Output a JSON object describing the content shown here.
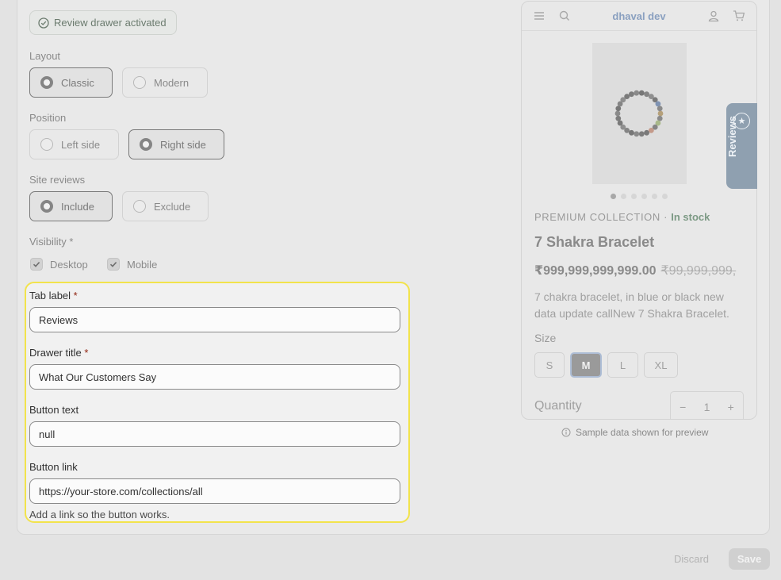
{
  "status_badge": {
    "text": "Review drawer activated"
  },
  "layout": {
    "label": "Layout",
    "options": [
      "Classic",
      "Modern"
    ],
    "selected": "Classic"
  },
  "position": {
    "label": "Position",
    "options": [
      "Left side",
      "Right side"
    ],
    "selected": "Right side"
  },
  "site_reviews": {
    "label": "Site reviews",
    "options": [
      "Include",
      "Exclude"
    ],
    "selected": "Include"
  },
  "visibility": {
    "label": "Visibility *",
    "options": [
      {
        "label": "Desktop",
        "checked": true
      },
      {
        "label": "Mobile",
        "checked": true
      }
    ]
  },
  "form": {
    "tab_label": {
      "label": "Tab label",
      "required_mark": "*",
      "value": "Reviews"
    },
    "drawer_title": {
      "label": "Drawer title",
      "required_mark": "*",
      "value": "What Our Customers Say"
    },
    "button_text": {
      "label": "Button text",
      "value": "null"
    },
    "button_link": {
      "label": "Button link",
      "value": "https://your-store.com/collections/all",
      "help": "Add a link so the button works."
    }
  },
  "preview": {
    "brand": "dhaval dev",
    "collection": "PREMIUM COLLECTION",
    "separator": "·",
    "stock": "In stock",
    "title": "7 Shakra Bracelet",
    "price": "₹999,999,999,999.00",
    "compare_price": "₹99,999,999,",
    "description": "7 chakra bracelet, in blue or black new data update callNew 7 Shakra Bracelet.",
    "size_label": "Size",
    "sizes": [
      "S",
      "M",
      "L",
      "XL"
    ],
    "selected_size": "M",
    "quantity_label": "Quantity",
    "quantity": "1",
    "minus": "−",
    "plus": "+",
    "reviews_tab": "Reviews",
    "sample_note": "Sample data shown for preview",
    "image_dots": {
      "count": 6,
      "active": 1
    }
  },
  "footer": {
    "discard": "Discard",
    "save": "Save"
  },
  "colors": {
    "focus_border": "#f2e34c",
    "reviews_tab": "#8fa0b0",
    "brand": "#8aa0c0",
    "in_stock": "#7d9a85",
    "required": "#8e1f0b"
  }
}
